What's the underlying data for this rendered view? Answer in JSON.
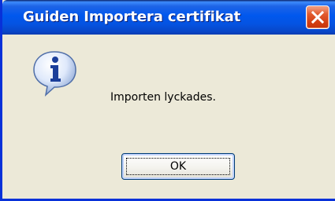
{
  "dialog": {
    "title": "Guiden Importera certifikat",
    "message": "Importen lyckades.",
    "ok_label": "OK",
    "icon": "info-icon",
    "close_icon": "close-icon"
  },
  "colors": {
    "titlebar": "#0058ee",
    "window_border": "#0831d9",
    "body_background": "#ece9d8",
    "close_button": "#d23d12",
    "button_border": "#003c74"
  }
}
